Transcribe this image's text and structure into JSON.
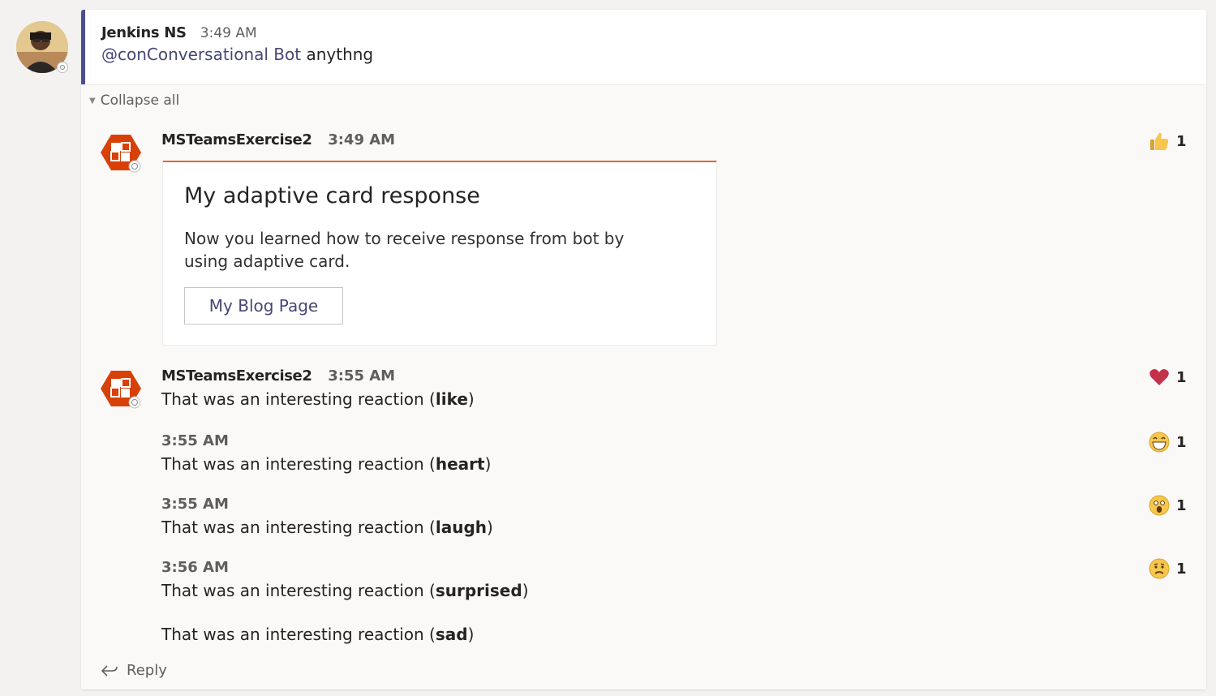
{
  "root": {
    "sender": "Jenkins NS",
    "time": "3:49 AM",
    "mention": "@conConversational Bot",
    "text": " anythng"
  },
  "collapse_label": "Collapse all",
  "bot_messages": [
    {
      "sender": "MSTeamsExercise2",
      "time": "3:49 AM",
      "card": {
        "title": "My adaptive card response",
        "body": "Now you learned how to receive response from bot by using adaptive card.",
        "button_label": "My Blog Page"
      },
      "reaction": {
        "icon": "thumbs-up-icon",
        "count": "1"
      }
    },
    {
      "sender": "MSTeamsExercise2",
      "time": "3:55 AM",
      "prefix": "That was an interesting reaction (",
      "keyword": "like",
      "suffix": ")",
      "reaction": {
        "icon": "heart-icon",
        "count": "1"
      }
    }
  ],
  "followups": [
    {
      "time": "3:55 AM",
      "prefix": "That was an interesting reaction (",
      "keyword": "heart",
      "suffix": ")",
      "reaction": {
        "icon": "laugh-icon",
        "count": "1"
      }
    },
    {
      "time": "3:55 AM",
      "prefix": "That was an interesting reaction (",
      "keyword": "laugh",
      "suffix": ")",
      "reaction": {
        "icon": "surprised-icon",
        "count": "1"
      }
    },
    {
      "time": "3:56 AM",
      "prefix": "That was an interesting reaction (",
      "keyword": "surprised",
      "suffix": ")",
      "reaction": {
        "icon": "sad-icon",
        "count": "1"
      }
    },
    {
      "prefix": "That was an interesting reaction (",
      "keyword": "sad",
      "suffix": ")"
    }
  ],
  "reply_label": "Reply",
  "colors": {
    "accent": "#4b4e8f",
    "card_accent": "#e8642d",
    "bot_avatar": "#d74108",
    "heart": "#c4314b",
    "emoji_yellow": "#f6c64d"
  }
}
